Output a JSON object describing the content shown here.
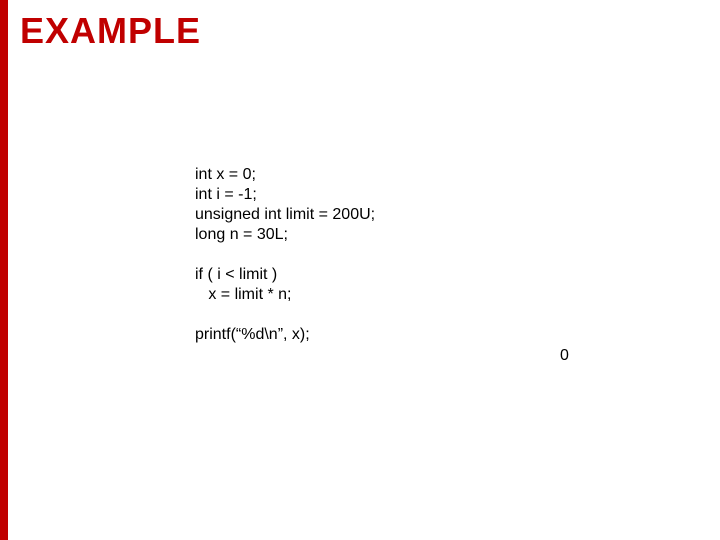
{
  "title": "EXAMPLE",
  "code": {
    "l1": "int x = 0;",
    "l2": "int i = -1;",
    "l3": "unsigned int limit = 200U;",
    "l4": "long n = 30L;",
    "l5": "",
    "l6": "if ( i < limit )",
    "l7": "   x = limit * n;",
    "l8": "",
    "l9": "printf(“%d\\n”, x);"
  },
  "output": "0"
}
